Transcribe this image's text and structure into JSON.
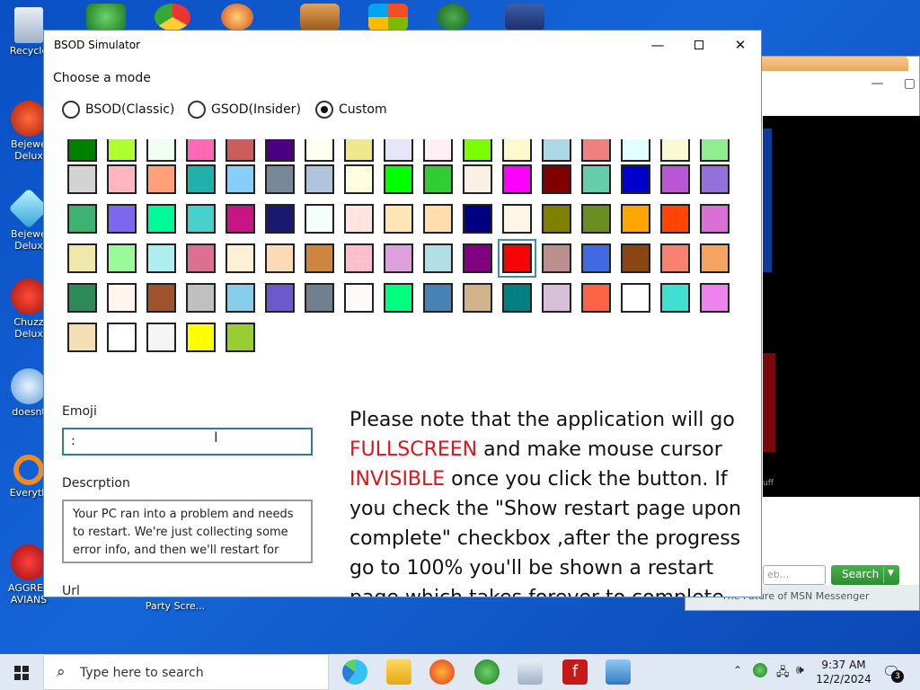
{
  "desktop": {
    "icons": [
      {
        "label": "Recycle"
      },
      {
        "label": "Bejewe Delux"
      },
      {
        "label": "Bejewe Delux"
      },
      {
        "label": "Chuzz Delux"
      },
      {
        "label": "doesnt"
      },
      {
        "label": "Everyth"
      },
      {
        "label": "AGGRES AVIANS"
      },
      {
        "label": "Party Scre..."
      }
    ]
  },
  "bg_window": {
    "search_placeholder": "eb...",
    "search_button": "Search",
    "status_text": "The Future of MSN Messenger",
    "side_text": "uff"
  },
  "window": {
    "title": "BSOD Simulator",
    "minimize": "—",
    "close": "✕"
  },
  "mode": {
    "label": "Choose a mode",
    "options": [
      {
        "label": "BSOD(Classic)",
        "checked": false
      },
      {
        "label": "GSOD(Insider)",
        "checked": false
      },
      {
        "label": "Custom",
        "checked": true
      }
    ]
  },
  "colors": [
    [
      "#008000",
      "#adff2f",
      "#f0fff0",
      "#ff69b4",
      "#cd5c5c",
      "#4b0082",
      "#fffff0",
      "#f0e68c",
      "#e6e6fa",
      "#fff0f5",
      "#7cfc00",
      "#fffacd",
      "#add8e6",
      "#f08080",
      "#e0ffff",
      "#fafad2",
      "#90ee90"
    ],
    [
      "#d3d3d3",
      "#ffb6c1",
      "#ffa07a",
      "#20b2aa",
      "#87cefa",
      "#778899",
      "#b0c4de",
      "#ffffe0",
      "#00ff00",
      "#32cd32",
      "#faf0e6",
      "#ff00ff",
      "#800000",
      "#66cdaa",
      "#0000cd",
      "#ba55d3",
      "#9370db"
    ],
    [
      "#3cb371",
      "#7b68ee",
      "#00fa9a",
      "#48d1cc",
      "#c71585",
      "#191970",
      "#f5fffa",
      "#ffe4e1",
      "#ffe4b5",
      "#ffdead",
      "#000080",
      "#fdf5e6",
      "#808000",
      "#6b8e23",
      "#ffa500",
      "#ff4500",
      "#da70d6"
    ],
    [
      "#eee8aa",
      "#98fb98",
      "#afeeee",
      "#db7093",
      "#ffefd5",
      "#ffdab9",
      "#cd853f",
      "#ffc0cb",
      "#dda0dd",
      "#b0e0e6",
      "#800080",
      "#ff0000",
      "#bc8f8f",
      "#4169e1",
      "#8b4513",
      "#fa8072",
      "#f4a460"
    ],
    [
      "#2e8b57",
      "#fff5ee",
      "#a0522d",
      "#c0c0c0",
      "#87ceeb",
      "#6a5acd",
      "#708090",
      "#fffafa",
      "#00ff7f",
      "#4682b4",
      "#d2b48c",
      "#008080",
      "#d8bfd8",
      "#ff6347",
      "#ffffff",
      "#40e0d0",
      "#ee82ee"
    ],
    [
      "#f5deb3",
      "#ffffff",
      "#f5f5f5",
      "#ffff00",
      "#9acd32"
    ]
  ],
  "selected_color": "#ff0000",
  "emoji": {
    "label": "Emoji",
    "value": ":"
  },
  "description": {
    "label": "Descrption",
    "value": "Your PC ran into a problem and needs to restart. We're just collecting some error info, and then we'll restart for you"
  },
  "url": {
    "label": "Url"
  },
  "note": {
    "part1": "Please note that the application will go ",
    "red1": "FULLSCREEN",
    "part2": " and make mouse cursor ",
    "red2": "INVISIBLE",
    "part3": " once you click the button. If you check the \"Show restart page upon complete\" checkbox ,after the progress go to 100% you'll be shown a restart page which takes forever to complete."
  },
  "taskbar": {
    "search_placeholder": "Type here to search",
    "time": "9:37 AM",
    "date": "12/2/2024",
    "notification_count": "3"
  }
}
